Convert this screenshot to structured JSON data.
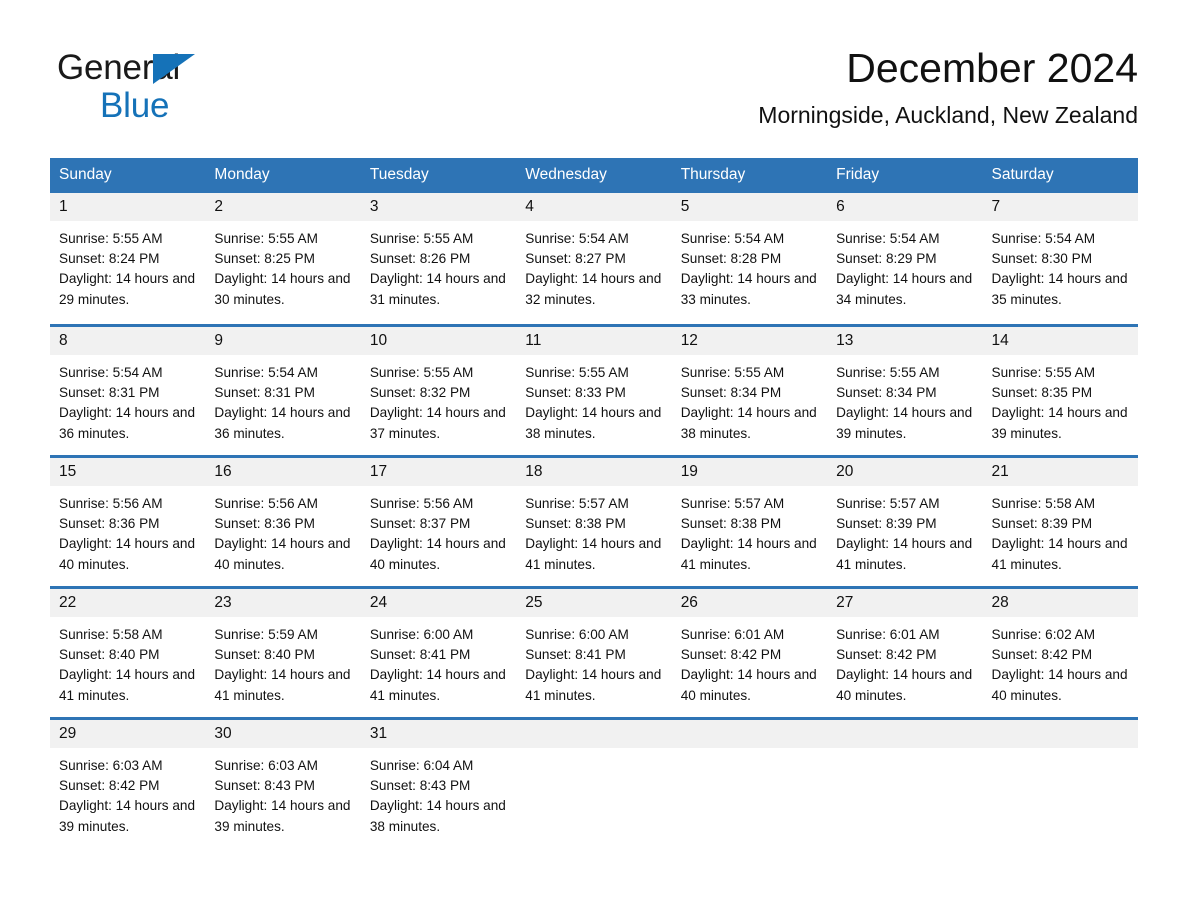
{
  "brand": {
    "name_part1": "General",
    "name_part2": "Blue",
    "logo_icon": "triangle-logo-icon",
    "accent_color": "#1572b8"
  },
  "header": {
    "title": "December 2024",
    "subtitle": "Morningside, Auckland, New Zealand"
  },
  "theme": {
    "header_blue": "#2e74b5",
    "daynum_gray": "#f1f1f1",
    "cell_white": "#ffffff"
  },
  "calendar": {
    "weekday_headers": [
      "Sunday",
      "Monday",
      "Tuesday",
      "Wednesday",
      "Thursday",
      "Friday",
      "Saturday"
    ],
    "weeks": [
      [
        {
          "day": "1",
          "sunrise": "Sunrise: 5:55 AM",
          "sunset": "Sunset: 8:24 PM",
          "daylight": "Daylight: 14 hours and 29 minutes."
        },
        {
          "day": "2",
          "sunrise": "Sunrise: 5:55 AM",
          "sunset": "Sunset: 8:25 PM",
          "daylight": "Daylight: 14 hours and 30 minutes."
        },
        {
          "day": "3",
          "sunrise": "Sunrise: 5:55 AM",
          "sunset": "Sunset: 8:26 PM",
          "daylight": "Daylight: 14 hours and 31 minutes."
        },
        {
          "day": "4",
          "sunrise": "Sunrise: 5:54 AM",
          "sunset": "Sunset: 8:27 PM",
          "daylight": "Daylight: 14 hours and 32 minutes."
        },
        {
          "day": "5",
          "sunrise": "Sunrise: 5:54 AM",
          "sunset": "Sunset: 8:28 PM",
          "daylight": "Daylight: 14 hours and 33 minutes."
        },
        {
          "day": "6",
          "sunrise": "Sunrise: 5:54 AM",
          "sunset": "Sunset: 8:29 PM",
          "daylight": "Daylight: 14 hours and 34 minutes."
        },
        {
          "day": "7",
          "sunrise": "Sunrise: 5:54 AM",
          "sunset": "Sunset: 8:30 PM",
          "daylight": "Daylight: 14 hours and 35 minutes."
        }
      ],
      [
        {
          "day": "8",
          "sunrise": "Sunrise: 5:54 AM",
          "sunset": "Sunset: 8:31 PM",
          "daylight": "Daylight: 14 hours and 36 minutes."
        },
        {
          "day": "9",
          "sunrise": "Sunrise: 5:54 AM",
          "sunset": "Sunset: 8:31 PM",
          "daylight": "Daylight: 14 hours and 36 minutes."
        },
        {
          "day": "10",
          "sunrise": "Sunrise: 5:55 AM",
          "sunset": "Sunset: 8:32 PM",
          "daylight": "Daylight: 14 hours and 37 minutes."
        },
        {
          "day": "11",
          "sunrise": "Sunrise: 5:55 AM",
          "sunset": "Sunset: 8:33 PM",
          "daylight": "Daylight: 14 hours and 38 minutes."
        },
        {
          "day": "12",
          "sunrise": "Sunrise: 5:55 AM",
          "sunset": "Sunset: 8:34 PM",
          "daylight": "Daylight: 14 hours and 38 minutes."
        },
        {
          "day": "13",
          "sunrise": "Sunrise: 5:55 AM",
          "sunset": "Sunset: 8:34 PM",
          "daylight": "Daylight: 14 hours and 39 minutes."
        },
        {
          "day": "14",
          "sunrise": "Sunrise: 5:55 AM",
          "sunset": "Sunset: 8:35 PM",
          "daylight": "Daylight: 14 hours and 39 minutes."
        }
      ],
      [
        {
          "day": "15",
          "sunrise": "Sunrise: 5:56 AM",
          "sunset": "Sunset: 8:36 PM",
          "daylight": "Daylight: 14 hours and 40 minutes."
        },
        {
          "day": "16",
          "sunrise": "Sunrise: 5:56 AM",
          "sunset": "Sunset: 8:36 PM",
          "daylight": "Daylight: 14 hours and 40 minutes."
        },
        {
          "day": "17",
          "sunrise": "Sunrise: 5:56 AM",
          "sunset": "Sunset: 8:37 PM",
          "daylight": "Daylight: 14 hours and 40 minutes."
        },
        {
          "day": "18",
          "sunrise": "Sunrise: 5:57 AM",
          "sunset": "Sunset: 8:38 PM",
          "daylight": "Daylight: 14 hours and 41 minutes."
        },
        {
          "day": "19",
          "sunrise": "Sunrise: 5:57 AM",
          "sunset": "Sunset: 8:38 PM",
          "daylight": "Daylight: 14 hours and 41 minutes."
        },
        {
          "day": "20",
          "sunrise": "Sunrise: 5:57 AM",
          "sunset": "Sunset: 8:39 PM",
          "daylight": "Daylight: 14 hours and 41 minutes."
        },
        {
          "day": "21",
          "sunrise": "Sunrise: 5:58 AM",
          "sunset": "Sunset: 8:39 PM",
          "daylight": "Daylight: 14 hours and 41 minutes."
        }
      ],
      [
        {
          "day": "22",
          "sunrise": "Sunrise: 5:58 AM",
          "sunset": "Sunset: 8:40 PM",
          "daylight": "Daylight: 14 hours and 41 minutes."
        },
        {
          "day": "23",
          "sunrise": "Sunrise: 5:59 AM",
          "sunset": "Sunset: 8:40 PM",
          "daylight": "Daylight: 14 hours and 41 minutes."
        },
        {
          "day": "24",
          "sunrise": "Sunrise: 6:00 AM",
          "sunset": "Sunset: 8:41 PM",
          "daylight": "Daylight: 14 hours and 41 minutes."
        },
        {
          "day": "25",
          "sunrise": "Sunrise: 6:00 AM",
          "sunset": "Sunset: 8:41 PM",
          "daylight": "Daylight: 14 hours and 41 minutes."
        },
        {
          "day": "26",
          "sunrise": "Sunrise: 6:01 AM",
          "sunset": "Sunset: 8:42 PM",
          "daylight": "Daylight: 14 hours and 40 minutes."
        },
        {
          "day": "27",
          "sunrise": "Sunrise: 6:01 AM",
          "sunset": "Sunset: 8:42 PM",
          "daylight": "Daylight: 14 hours and 40 minutes."
        },
        {
          "day": "28",
          "sunrise": "Sunrise: 6:02 AM",
          "sunset": "Sunset: 8:42 PM",
          "daylight": "Daylight: 14 hours and 40 minutes."
        }
      ],
      [
        {
          "day": "29",
          "sunrise": "Sunrise: 6:03 AM",
          "sunset": "Sunset: 8:42 PM",
          "daylight": "Daylight: 14 hours and 39 minutes."
        },
        {
          "day": "30",
          "sunrise": "Sunrise: 6:03 AM",
          "sunset": "Sunset: 8:43 PM",
          "daylight": "Daylight: 14 hours and 39 minutes."
        },
        {
          "day": "31",
          "sunrise": "Sunrise: 6:04 AM",
          "sunset": "Sunset: 8:43 PM",
          "daylight": "Daylight: 14 hours and 38 minutes."
        },
        {
          "day": "",
          "sunrise": "",
          "sunset": "",
          "daylight": ""
        },
        {
          "day": "",
          "sunrise": "",
          "sunset": "",
          "daylight": ""
        },
        {
          "day": "",
          "sunrise": "",
          "sunset": "",
          "daylight": ""
        },
        {
          "day": "",
          "sunrise": "",
          "sunset": "",
          "daylight": ""
        }
      ]
    ]
  }
}
